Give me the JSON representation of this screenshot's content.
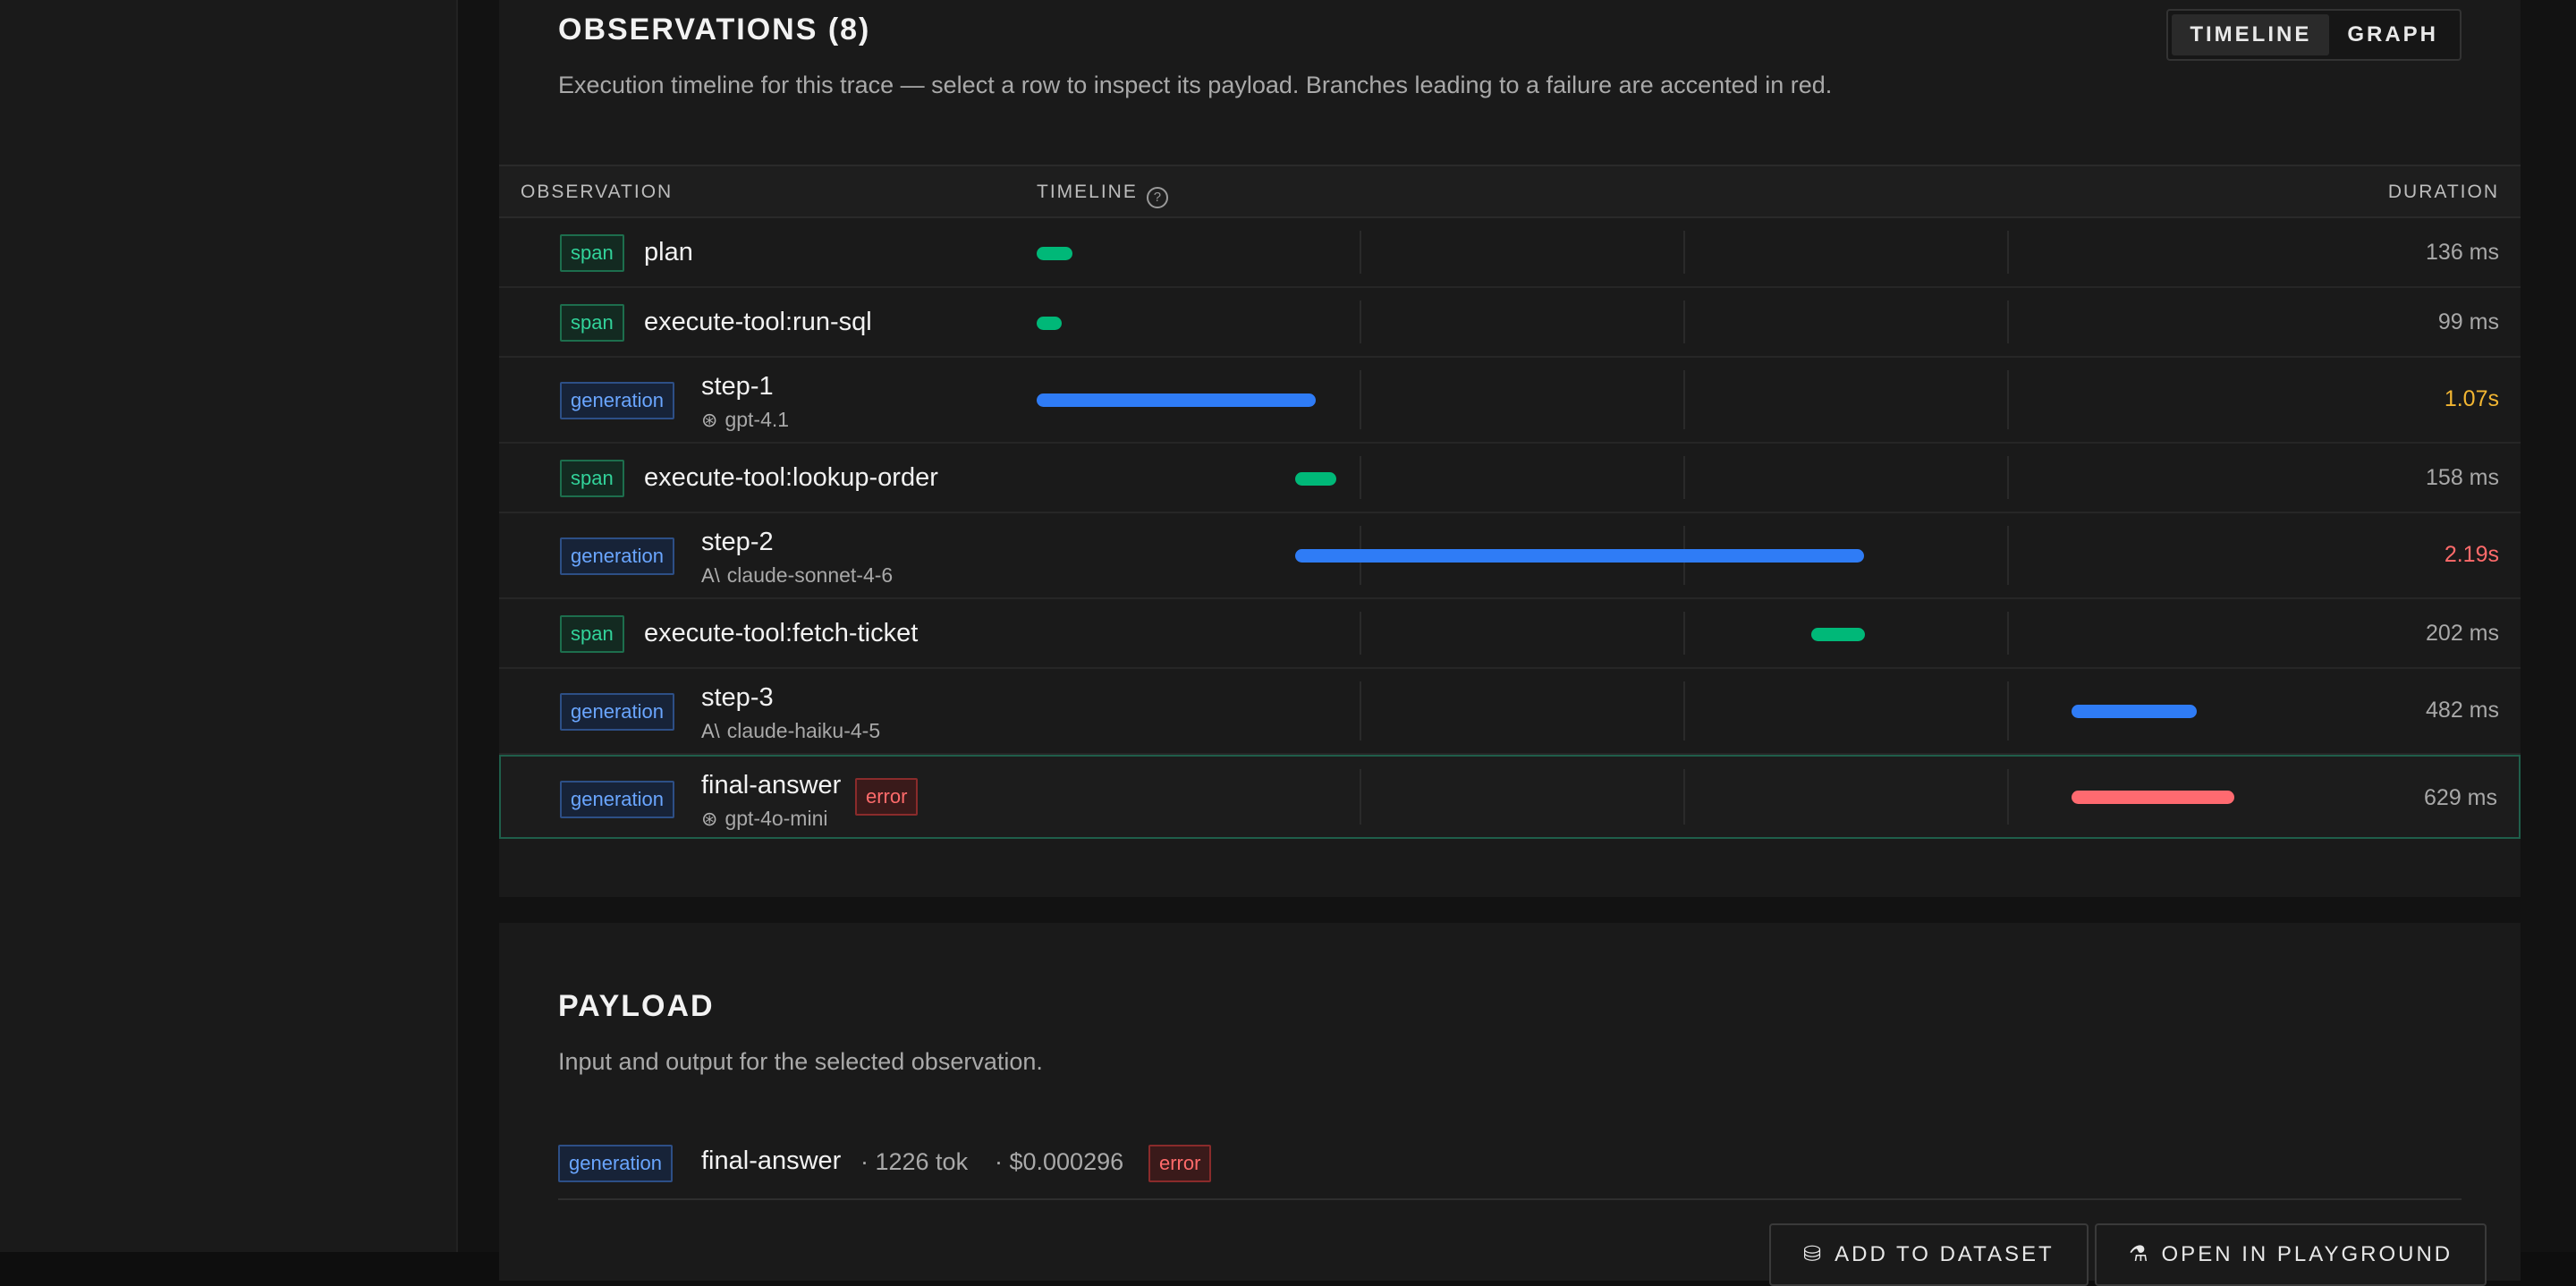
{
  "observations": {
    "title": "OBSERVATIONS (8)",
    "subtitle": "Execution timeline for this trace — select a row to inspect its payload. Branches leading to a failure are accented in red.",
    "view_toggle": {
      "timeline": "TIMELINE",
      "graph": "GRAPH",
      "selected": "timeline"
    },
    "columns": {
      "observation": "OBSERVATION",
      "timeline": "TIMELINE",
      "duration": "DURATION"
    },
    "rows": [
      {
        "type": "span",
        "name": "plan",
        "model": "",
        "duration": "136 ms"
      },
      {
        "type": "span",
        "name": "execute-tool:run-sql",
        "model": "",
        "duration": "99 ms"
      },
      {
        "type": "generation",
        "name": "step-1",
        "model": "gpt-4.1",
        "duration": "1.07s"
      },
      {
        "type": "span",
        "name": "execute-tool:lookup-order",
        "model": "",
        "duration": "158 ms"
      },
      {
        "type": "generation",
        "name": "step-2",
        "model": "claude-sonnet-4-6",
        "duration": "2.19s"
      },
      {
        "type": "span",
        "name": "execute-tool:fetch-ticket",
        "model": "",
        "duration": "202 ms"
      },
      {
        "type": "generation",
        "name": "step-3",
        "model": "claude-haiku-4-5",
        "duration": "482 ms"
      },
      {
        "type": "generation",
        "name": "final-answer",
        "model": "gpt-4o-mini",
        "duration": "629 ms",
        "status": "error"
      }
    ],
    "error_label": "error"
  },
  "payload": {
    "title": "PAYLOAD",
    "subtitle": "Input and output for the selected observation.",
    "selected": {
      "type": "generation",
      "name": "final-answer",
      "tokens": "· 1226 tok",
      "cost": "· $0.000296",
      "status": "error"
    },
    "actions": {
      "add_to_dataset": "ADD TO DATASET",
      "open_in_playground": "OPEN IN PLAYGROUND"
    }
  },
  "icons": {
    "help": "help-circle-icon",
    "openai": "openai-icon",
    "anthropic": "anthropic-icon",
    "dataset": "database-icon",
    "playground": "flask-icon"
  },
  "colors": {
    "span": "#00b878",
    "generation": "#2f7cf6",
    "error": "#ff6a70",
    "warn": "#f2b632"
  }
}
